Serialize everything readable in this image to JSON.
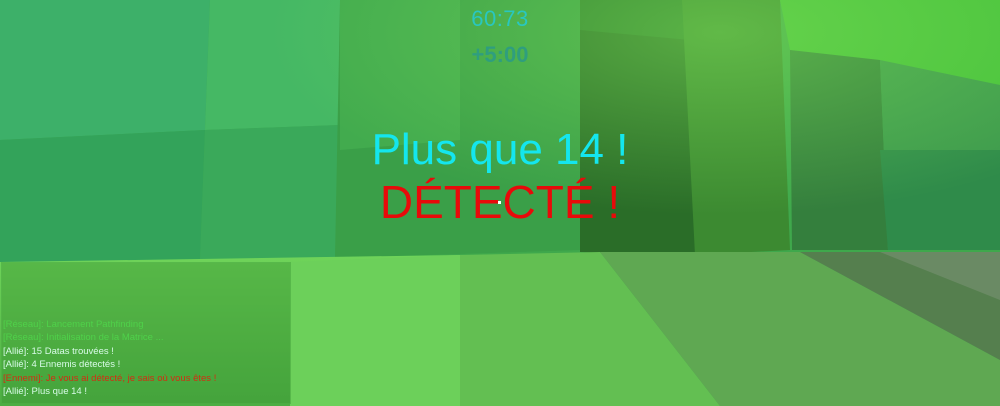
{
  "hud": {
    "timer": "60:73",
    "time_bonus": "+5:00"
  },
  "center": {
    "remaining_message": "Plus que 14 !",
    "alert_message": "DÉTECTÉ !"
  },
  "log": {
    "lines": [
      {
        "text": "[Réseau]: Lancement Pathfinding",
        "color": "#4fd14a"
      },
      {
        "text": "[Réseau]: Initialisation de la Matrice ...",
        "color": "#4fd14a"
      },
      {
        "text": "[Allié]: 15 Datas trouvées !",
        "color": "#d8fbe8"
      },
      {
        "text": "[Allié]: 4 Ennemis détectés !",
        "color": "#d8fbe8"
      },
      {
        "text": "[Ennemi]: Je vous ai détecté, je sais où vous êtes !",
        "color": "#d12f12"
      },
      {
        "text": "[Allié]: Plus que 14 !",
        "color": "#d8fbe8"
      }
    ]
  },
  "colors": {
    "timer": "#29c7c0",
    "bonus": "#2f9e7e",
    "remaining": "#14e6ee",
    "alert": "#e80a0a",
    "environment": "#3fa84c"
  }
}
